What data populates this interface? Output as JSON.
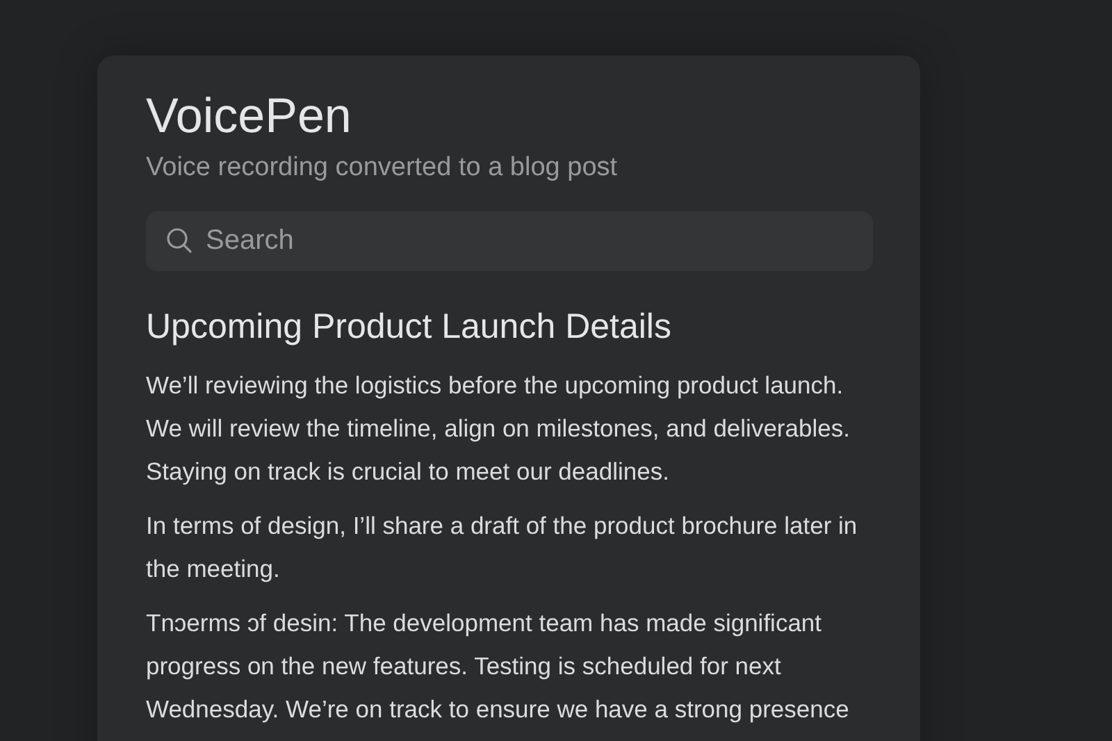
{
  "app": {
    "title": "VoicePen",
    "subtitle": "Voice recording converted to a blog post"
  },
  "search": {
    "placeholder": "Search"
  },
  "post": {
    "title": "Upcoming Product Launch Details",
    "paragraphs": [
      "We’ll reviewing the logistics before the upcoming product launch. We will review the timeline, align on milestones, and deliverables. Staying on track is crucial to meet our deadlines.",
      "In terms of design, I’ll share a draft of the product brochure later in the meeting.",
      "Tnɔerms ɔf desin: The development team has made significant progress on the new features. Testing is scheduled for next Wednesday. We’re on track to ensure we have a strong presence"
    ]
  }
}
